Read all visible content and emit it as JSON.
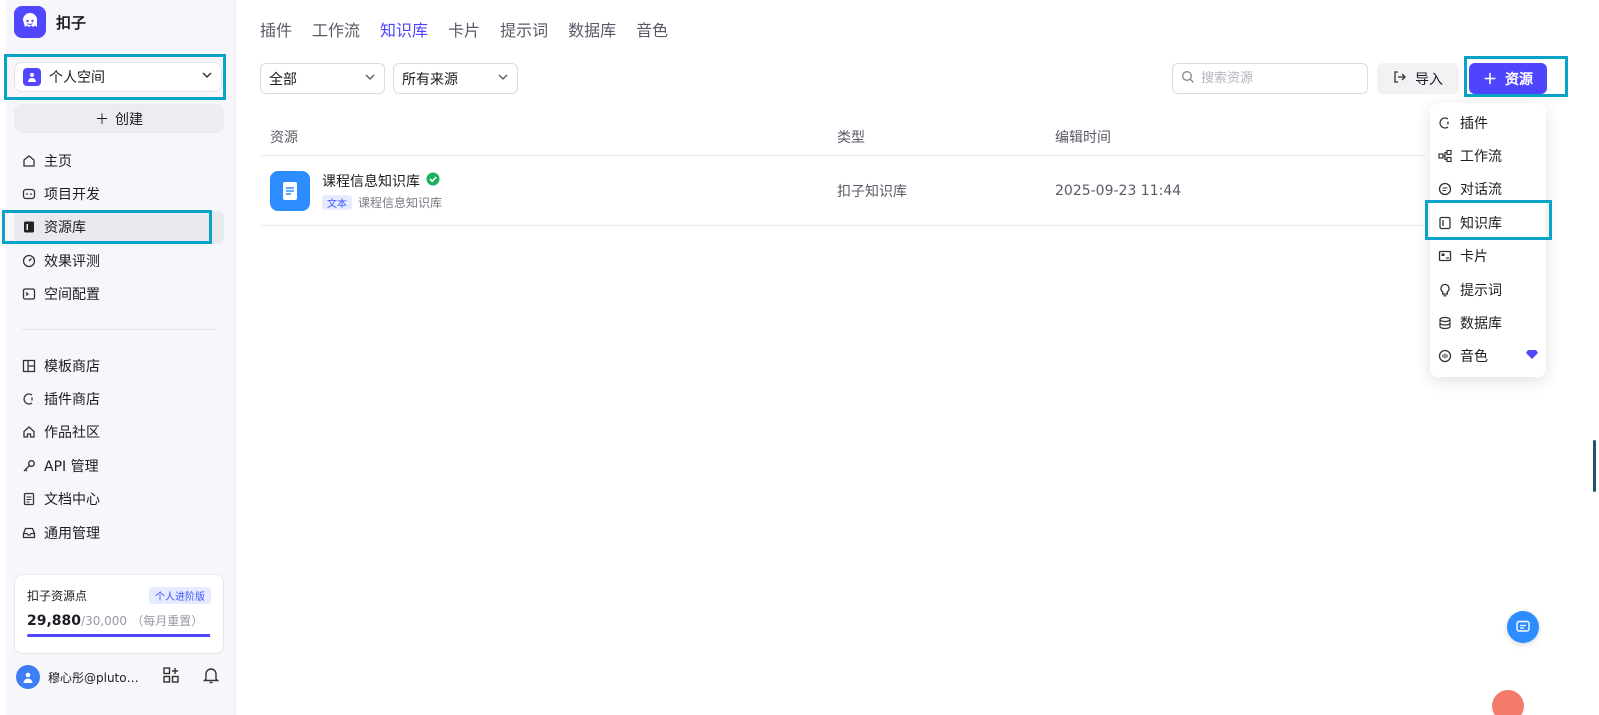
{
  "app": {
    "name": "扣子"
  },
  "sidebar": {
    "space_label": "个人空间",
    "create_label": "创建",
    "nav_top": [
      {
        "label": "主页",
        "icon": "home-icon"
      },
      {
        "label": "项目开发",
        "icon": "robot-icon"
      },
      {
        "label": "资源库",
        "icon": "library-icon",
        "active": true
      },
      {
        "label": "效果评测",
        "icon": "gauge-icon"
      },
      {
        "label": "空间配置",
        "icon": "terminal-icon"
      }
    ],
    "nav_bottom": [
      {
        "label": "模板商店",
        "icon": "template-icon"
      },
      {
        "label": "插件商店",
        "icon": "plugin-icon"
      },
      {
        "label": "作品社区",
        "icon": "community-icon"
      },
      {
        "label": "API 管理",
        "icon": "key-icon"
      },
      {
        "label": "文档中心",
        "icon": "doc-icon"
      },
      {
        "label": "通用管理",
        "icon": "inbox-icon"
      }
    ],
    "points": {
      "title": "扣子资源点",
      "badge": "个人进阶版",
      "value": "29,880",
      "total": "/30,000",
      "note": "（每月重置）",
      "fraction": 0.996
    },
    "user": {
      "name": "穆心彤@pluto…"
    }
  },
  "tabs": [
    {
      "label": "插件",
      "active": false
    },
    {
      "label": "工作流",
      "active": false
    },
    {
      "label": "知识库",
      "active": true
    },
    {
      "label": "卡片",
      "active": false
    },
    {
      "label": "提示词",
      "active": false
    },
    {
      "label": "数据库",
      "active": false
    },
    {
      "label": "音色",
      "active": false
    }
  ],
  "toolbar": {
    "filter_type": "全部",
    "filter_source": "所有来源",
    "search_placeholder": "搜索资源",
    "import_label": "导入",
    "add_label": "资源"
  },
  "table": {
    "headers": {
      "resource": "资源",
      "type": "类型",
      "time": "编辑时间"
    },
    "rows": [
      {
        "name": "课程信息知识库",
        "tag": "文本",
        "desc": "课程信息知识库",
        "type": "扣子知识库",
        "time": "2025-09-23 11:44"
      }
    ]
  },
  "dropdown": {
    "items": [
      {
        "label": "插件",
        "icon": "plugin-icon"
      },
      {
        "label": "工作流",
        "icon": "workflow-icon"
      },
      {
        "label": "对话流",
        "icon": "chat-flow-icon"
      },
      {
        "label": "知识库",
        "icon": "knowledge-icon"
      },
      {
        "label": "卡片",
        "icon": "card-icon"
      },
      {
        "label": "提示词",
        "icon": "bulb-icon"
      },
      {
        "label": "数据库",
        "icon": "database-icon"
      },
      {
        "label": "音色",
        "icon": "voice-icon",
        "premium": true
      }
    ]
  },
  "colors": {
    "accent": "#4f45ff",
    "highlight": "#08a3c6",
    "file_icon": "#2d8cff"
  }
}
